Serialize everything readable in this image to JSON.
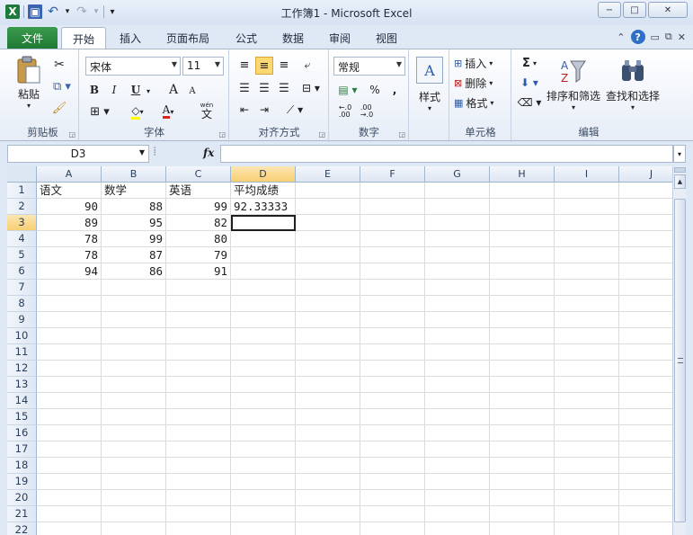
{
  "window": {
    "title": "工作簿1 - Microsoft Excel",
    "app_icon": "excel-logo-icon",
    "minimize": "−",
    "maximize": "□",
    "close": "✕"
  },
  "qat": {
    "save": "save-icon",
    "undo_glyph": "↶",
    "redo_glyph": "↷",
    "dropdown_glyph": "▾"
  },
  "tabs": [
    {
      "label": "文件"
    },
    {
      "label": "开始"
    },
    {
      "label": "插入"
    },
    {
      "label": "页面布局"
    },
    {
      "label": "公式"
    },
    {
      "label": "数据"
    },
    {
      "label": "审阅"
    },
    {
      "label": "视图"
    }
  ],
  "ribbon": {
    "clipboard": {
      "label": "剪贴板",
      "paste": "粘贴"
    },
    "font": {
      "label": "字体",
      "name": "宋体",
      "size": "11",
      "bold": "B",
      "italic": "I",
      "underline": "U",
      "grow": "A",
      "shrink": "A",
      "font_color": "A",
      "phonetic_top": "wén",
      "phonetic": "文"
    },
    "alignment": {
      "label": "对齐方式"
    },
    "number": {
      "label": "数字",
      "format": "常规",
      "percent": "%",
      "comma": ","
    },
    "styles": {
      "label": "样式"
    },
    "cells": {
      "label": "单元格",
      "insert": "插入",
      "delete": "删除",
      "format": "格式"
    },
    "editing": {
      "label": "编辑",
      "sigma": "Σ",
      "sort_filter": "排序和筛选",
      "find_select": "查找和选择"
    }
  },
  "formula_bar": {
    "name_box": "D3",
    "fx": "fx",
    "value": ""
  },
  "grid": {
    "columns": [
      "A",
      "B",
      "C",
      "D",
      "E",
      "F",
      "G",
      "H",
      "I",
      "J"
    ],
    "rows": [
      "1",
      "2",
      "3",
      "4",
      "5",
      "6",
      "7",
      "8",
      "9",
      "10",
      "11",
      "12",
      "13",
      "14",
      "15",
      "16",
      "17",
      "18",
      "19",
      "20",
      "21",
      "22"
    ],
    "cells": [
      [
        "语文",
        "数学",
        "英语",
        "平均成绩"
      ],
      [
        "90",
        "88",
        "99",
        "92.33333"
      ],
      [
        "89",
        "95",
        "82",
        ""
      ],
      [
        "78",
        "99",
        "80",
        ""
      ],
      [
        "78",
        "87",
        "79",
        ""
      ],
      [
        "94",
        "86",
        "91",
        ""
      ]
    ]
  }
}
